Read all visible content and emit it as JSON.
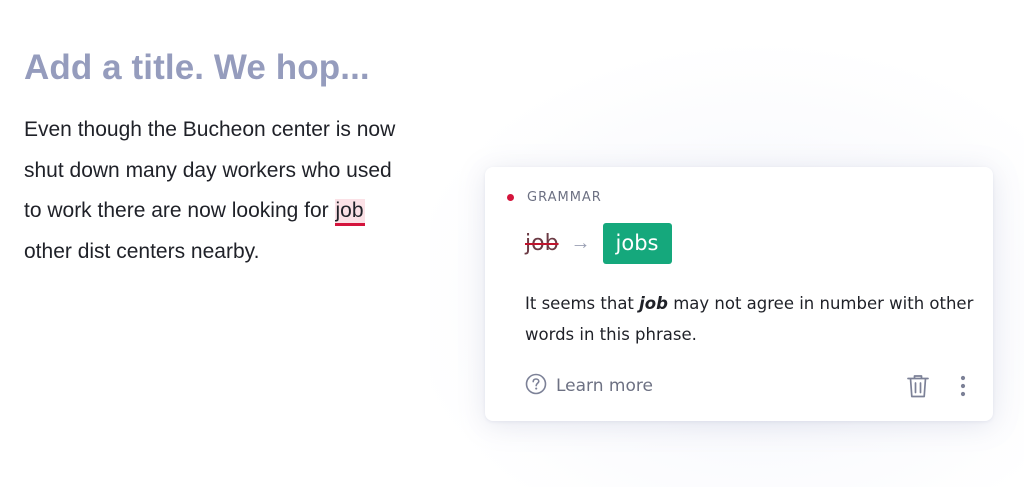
{
  "editor": {
    "title": "Add a title. We hop...",
    "body_before": "Even though the Bucheon center is now shut down many day workers who used to work there are now looking for ",
    "flagged_word": "job",
    "body_after": " other dist centers nearby."
  },
  "suggestion_card": {
    "category": "GRAMMAR",
    "original_word": "job",
    "arrow": "→",
    "replacement": "jobs",
    "explanation_before": "It seems that ",
    "explanation_word": "job",
    "explanation_after": " may not agree in number with other words in this phrase.",
    "learn_more_label": "Learn more",
    "icons": {
      "help": "question-circle-icon",
      "delete": "trash-icon",
      "more": "vertical-ellipsis-icon"
    }
  },
  "colors": {
    "title": "#959cbd",
    "error_red": "#d4143c",
    "highlight": "#fbe1e6",
    "accept_green": "#15a87c",
    "muted": "#6d7183"
  }
}
